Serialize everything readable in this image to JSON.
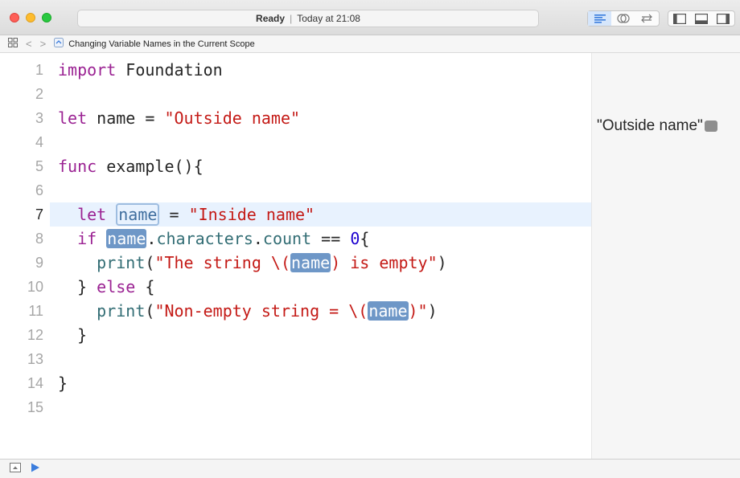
{
  "status": {
    "state": "Ready",
    "separator": "|",
    "time": "Today at 21:08"
  },
  "toolbar": {
    "editor_mode_icons": [
      "standard-editor-icon",
      "assistant-editor-icon",
      "version-editor-icon"
    ],
    "panel_icons": [
      "navigator-panel-icon",
      "debug-area-icon",
      "utilities-panel-icon"
    ]
  },
  "jumpbar": {
    "back": "<",
    "forward": ">",
    "file_name": "Changing Variable Names in the Current Scope"
  },
  "editor": {
    "current_line": 7,
    "line_numbers": [
      "1",
      "2",
      "3",
      "4",
      "5",
      "6",
      "7",
      "8",
      "9",
      "10",
      "11",
      "12",
      "13",
      "14",
      "15"
    ],
    "lines": [
      {
        "n": 1,
        "tokens": [
          [
            "kw",
            "import"
          ],
          [
            "plain",
            " Foundation"
          ]
        ]
      },
      {
        "n": 2,
        "tokens": []
      },
      {
        "n": 3,
        "tokens": [
          [
            "kw",
            "let"
          ],
          [
            "plain",
            " name = "
          ],
          [
            "str",
            "\"Outside name\""
          ]
        ]
      },
      {
        "n": 4,
        "tokens": []
      },
      {
        "n": 5,
        "tokens": [
          [
            "kw",
            "func"
          ],
          [
            "plain",
            " example(){"
          ]
        ]
      },
      {
        "n": 6,
        "tokens": []
      },
      {
        "n": 7,
        "tokens": [
          [
            "plain",
            "  "
          ],
          [
            "kw",
            "let"
          ],
          [
            "plain",
            " "
          ],
          [
            "box",
            "name"
          ],
          [
            "plain",
            " = "
          ],
          [
            "str",
            "\"Inside name\""
          ]
        ]
      },
      {
        "n": 8,
        "tokens": [
          [
            "plain",
            "  "
          ],
          [
            "kw",
            "if"
          ],
          [
            "plain",
            " "
          ],
          [
            "sel",
            "name"
          ],
          [
            "plain",
            "."
          ],
          [
            "fn",
            "characters"
          ],
          [
            "plain",
            "."
          ],
          [
            "fn",
            "count"
          ],
          [
            "plain",
            " == "
          ],
          [
            "num",
            "0"
          ],
          [
            "plain",
            "{"
          ]
        ]
      },
      {
        "n": 9,
        "tokens": [
          [
            "plain",
            "    "
          ],
          [
            "fn",
            "print"
          ],
          [
            "plain",
            "("
          ],
          [
            "str",
            "\"The string \\("
          ],
          [
            "sel",
            "name"
          ],
          [
            "str",
            ") is empty\""
          ],
          [
            "plain",
            ")"
          ]
        ]
      },
      {
        "n": 10,
        "tokens": [
          [
            "plain",
            "  } "
          ],
          [
            "kw",
            "else"
          ],
          [
            "plain",
            " {"
          ]
        ]
      },
      {
        "n": 11,
        "tokens": [
          [
            "plain",
            "    "
          ],
          [
            "fn",
            "print"
          ],
          [
            "plain",
            "("
          ],
          [
            "str",
            "\"Non-empty string = \\("
          ],
          [
            "sel",
            "name"
          ],
          [
            "str",
            ")\""
          ],
          [
            "plain",
            ")"
          ]
        ]
      },
      {
        "n": 12,
        "tokens": [
          [
            "plain",
            "  }"
          ]
        ]
      },
      {
        "n": 13,
        "tokens": []
      },
      {
        "n": 14,
        "tokens": [
          [
            "plain",
            "}"
          ]
        ]
      },
      {
        "n": 15,
        "tokens": []
      }
    ]
  },
  "results": {
    "line3": "\"Outside name\""
  },
  "bottombar": {
    "toggle_icon": "hide-debug-area-icon",
    "run_icon": "play-icon"
  },
  "colors": {
    "keyword": "#9b2393",
    "string": "#c41a16",
    "number": "#1c00cf",
    "identifier": "#326d74",
    "selection": "#6e97c7",
    "current_line": "#e8f2fe"
  }
}
